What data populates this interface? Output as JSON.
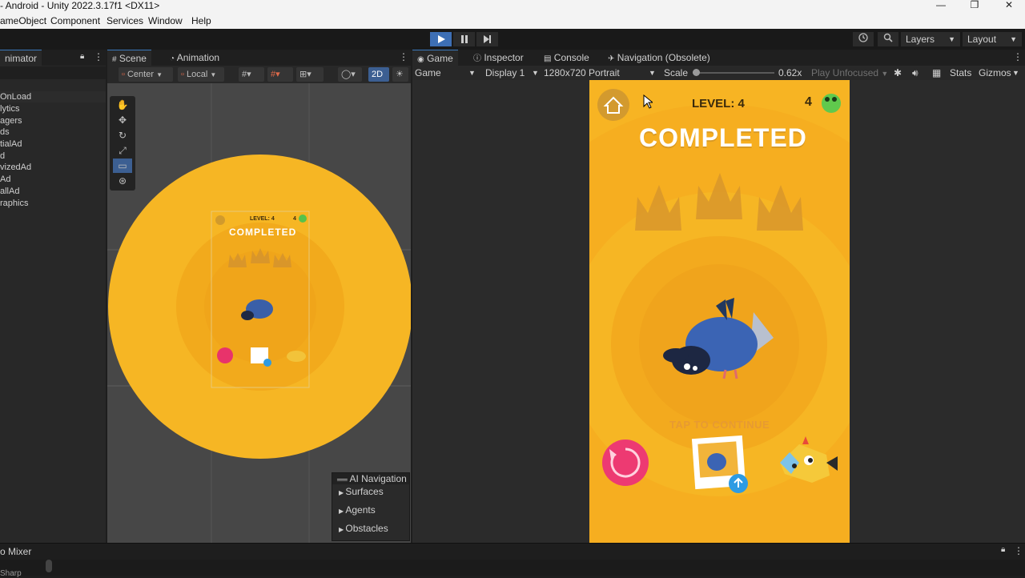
{
  "window": {
    "title": "- Android - Unity 2022.3.17f1 <DX11>",
    "minimize": "—",
    "restore": "❐",
    "close": "✕"
  },
  "menu": [
    "ameObject",
    "Component",
    "Services",
    "Window",
    "Help"
  ],
  "toolbar": {
    "play_icon": "play-icon",
    "pause_icon": "pause-icon",
    "step_icon": "step-icon",
    "layers_label": "Layers",
    "layout_label": "Layout"
  },
  "hierarchy": {
    "tab_label": "nimator",
    "items": [
      "OnLoad",
      "lytics",
      "agers",
      "ds",
      "tialAd",
      "d",
      "vizedAd",
      "Ad",
      "allAd",
      "raphics"
    ]
  },
  "scene_tabs": {
    "scene": "Scene",
    "animation": "Animation"
  },
  "scene_toolbar": {
    "pivot": "Center",
    "space": "Local",
    "mode_2d": "2D"
  },
  "ai_navigation": {
    "title": "AI Navigation",
    "items": [
      "Surfaces",
      "Agents",
      "Obstacles"
    ]
  },
  "game_tabs": {
    "game": "Game",
    "inspector": "Inspector",
    "console": "Console",
    "navigation": "Navigation (Obsolete)"
  },
  "game_toolbar": {
    "view": "Game",
    "display": "Display 1",
    "resolution": "1280x720 Portrait",
    "scale_label": "Scale",
    "scale_value": "0.62x",
    "play_mode": "Play Unfocused",
    "stats": "Stats",
    "gizmos": "Gizmos",
    "scale_fraction": 0.04
  },
  "game": {
    "level_label": "LEVEL: 4",
    "coin_count": "4",
    "completed": "COMPLETED",
    "tap_to_continue": "TAP TO CONTINUE",
    "crowns": 3,
    "background": "#f7b423"
  },
  "scene_preview": {
    "level_label": "LEVEL: 4",
    "coin_count": "4",
    "completed": "COMPLETED"
  },
  "bottom": {
    "tab_label": "o Mixer",
    "footer": "Sharp"
  }
}
